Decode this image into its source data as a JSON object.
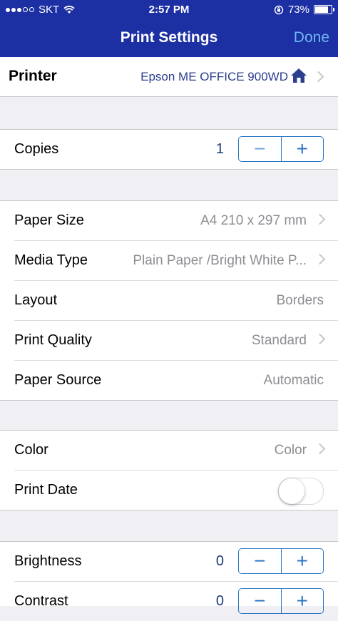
{
  "status": {
    "carrier": "SKT",
    "time": "2:57 PM",
    "battery": "73%",
    "battery_level": 0.73,
    "signal_bars_filled": 3,
    "signal_bars_total": 5
  },
  "nav": {
    "title": "Print Settings",
    "done": "Done"
  },
  "printer": {
    "label": "Printer",
    "value": "Epson ME OFFICE 900WD"
  },
  "copies": {
    "label": "Copies",
    "value": "1",
    "minus": "−",
    "plus": "+"
  },
  "paper": {
    "paper_size": {
      "label": "Paper Size",
      "value": "A4 210 x 297 mm"
    },
    "media_type": {
      "label": "Media Type",
      "value": "Plain Paper /Bright White P..."
    },
    "layout": {
      "label": "Layout",
      "value": "Borders"
    },
    "print_quality": {
      "label": "Print Quality",
      "value": "Standard"
    },
    "paper_source": {
      "label": "Paper Source",
      "value": "Automatic"
    }
  },
  "color": {
    "color": {
      "label": "Color",
      "value": "Color"
    },
    "print_date": {
      "label": "Print Date",
      "on": false
    }
  },
  "adjust": {
    "brightness": {
      "label": "Brightness",
      "value": "0",
      "minus": "−",
      "plus": "+"
    },
    "contrast": {
      "label": "Contrast",
      "value": "0",
      "minus": "−",
      "plus": "+"
    }
  },
  "colors": {
    "nav_bg": "#1c2fa3",
    "done": "#6fb7f2",
    "accent": "#2a74c4",
    "group_bg": "#efeff4"
  }
}
